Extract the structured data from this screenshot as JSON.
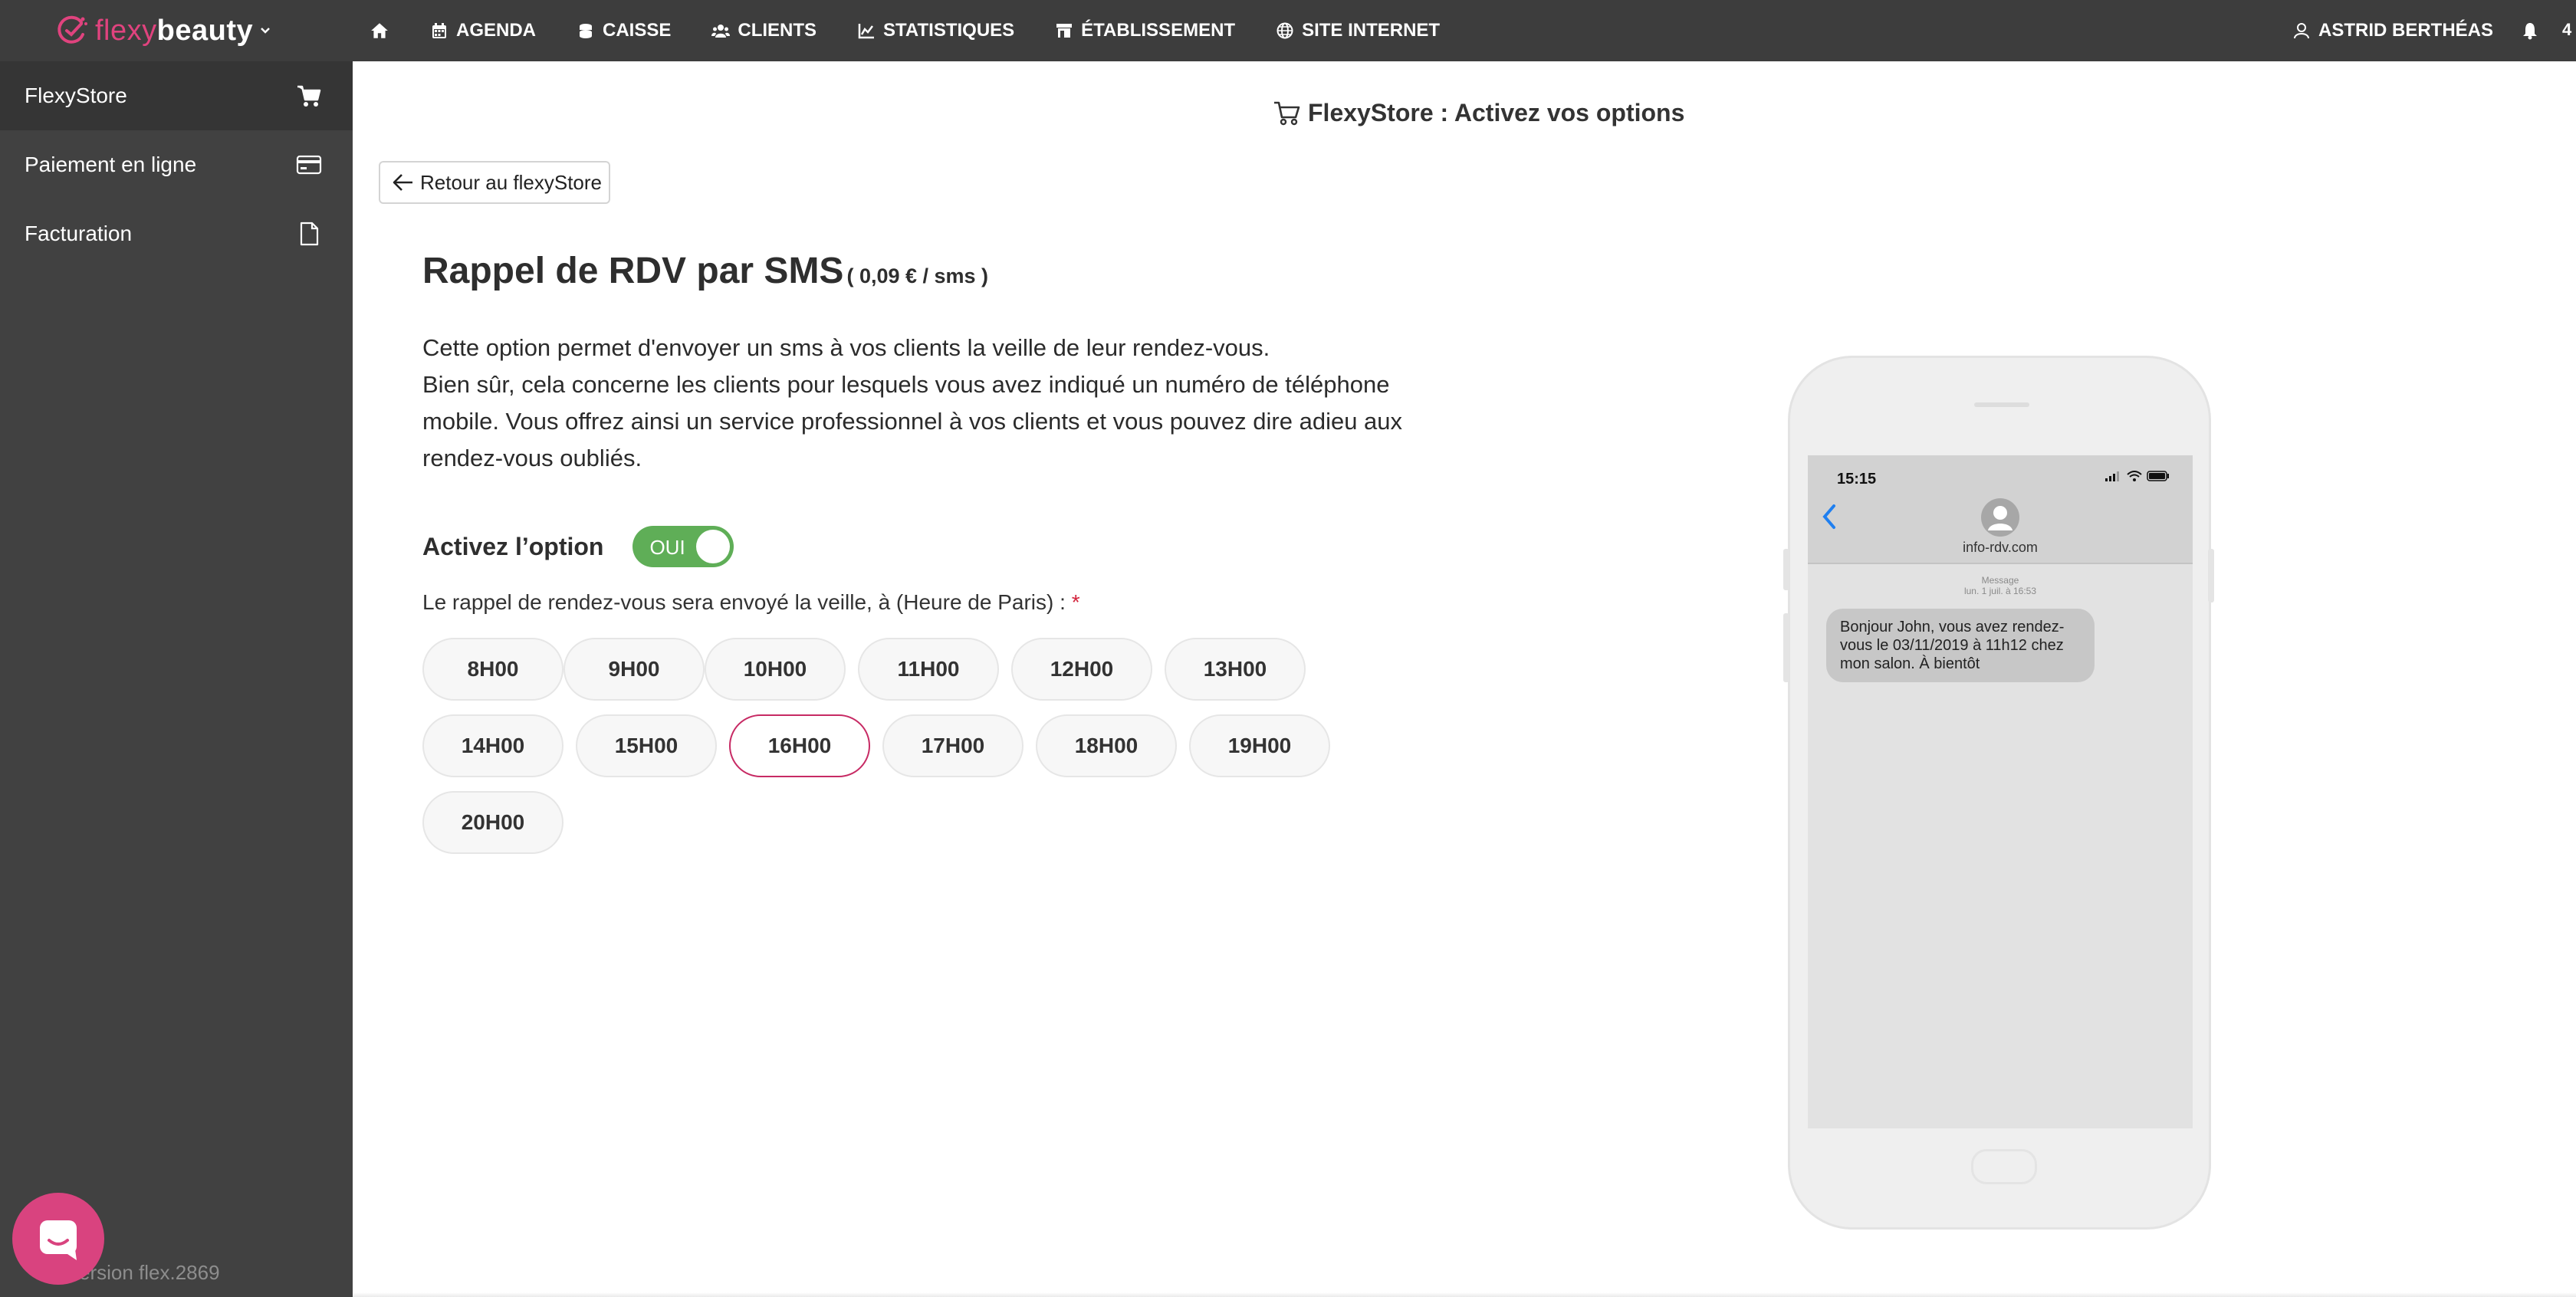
{
  "app": {
    "logo_flexy": "flexy",
    "logo_beauty": "beauty",
    "accent_color": "#e0437e"
  },
  "nav": {
    "items": [
      {
        "label": "",
        "icon": "home-icon"
      },
      {
        "label": "AGENDA",
        "icon": "calendar-icon"
      },
      {
        "label": "CAISSE",
        "icon": "coins-icon"
      },
      {
        "label": "CLIENTS",
        "icon": "users-icon"
      },
      {
        "label": "STATISTIQUES",
        "icon": "chart-icon"
      },
      {
        "label": "ÉTABLISSEMENT",
        "icon": "store-icon"
      },
      {
        "label": "SITE INTERNET",
        "icon": "globe-icon"
      }
    ],
    "user_name": "ASTRID BERTHÉAS",
    "notifications_count": "4"
  },
  "sidebar": {
    "items": [
      {
        "label": "FlexyStore",
        "icon": "cart-icon",
        "active": true
      },
      {
        "label": "Paiement en ligne",
        "icon": "credit-card-icon",
        "active": false
      },
      {
        "label": "Facturation",
        "icon": "document-icon",
        "active": false
      }
    ],
    "version": "version flex.2869"
  },
  "main": {
    "page_title": "FlexyStore : Activez vos options",
    "back_label": "Retour au flexyStore",
    "title": "Rappel de RDV par SMS",
    "price": "( 0,09 €  / sms )",
    "description": [
      "Cette option permet d'envoyer un sms à vos clients la veille de leur rendez-vous.",
      "Bien sûr, cela concerne les clients pour lesquels vous avez indiqué un numéro de téléphone mobile. Vous offrez ainsi un service professionnel à vos clients et vous pouvez dire adieu aux rendez-vous oubliés."
    ],
    "option_label": "Activez l’option",
    "toggle_label": "OUI",
    "toggle_on": true,
    "toggle_color": "#5fae57",
    "reminder_label": "Le rappel de rendez-vous sera envoyé la veille, à (Heure de Paris) :",
    "required_mark": "*",
    "hours": [
      "8H00",
      "9H00",
      "10H00",
      "11H00",
      "12H00",
      "13H00",
      "14H00",
      "15H00",
      "16H00",
      "17H00",
      "18H00",
      "19H00",
      "20H00"
    ],
    "selected_hour": "16H00",
    "selected_color": "#c72a64"
  },
  "phone": {
    "time": "15:15",
    "contact": "info-rdv.com",
    "meta_line1": "Message",
    "meta_line2": "lun. 1 juil. à 16:53",
    "message": "Bonjour John, vous avez rendez-vous le 03/11/2019 à 11h12 chez mon salon. À bientôt"
  }
}
